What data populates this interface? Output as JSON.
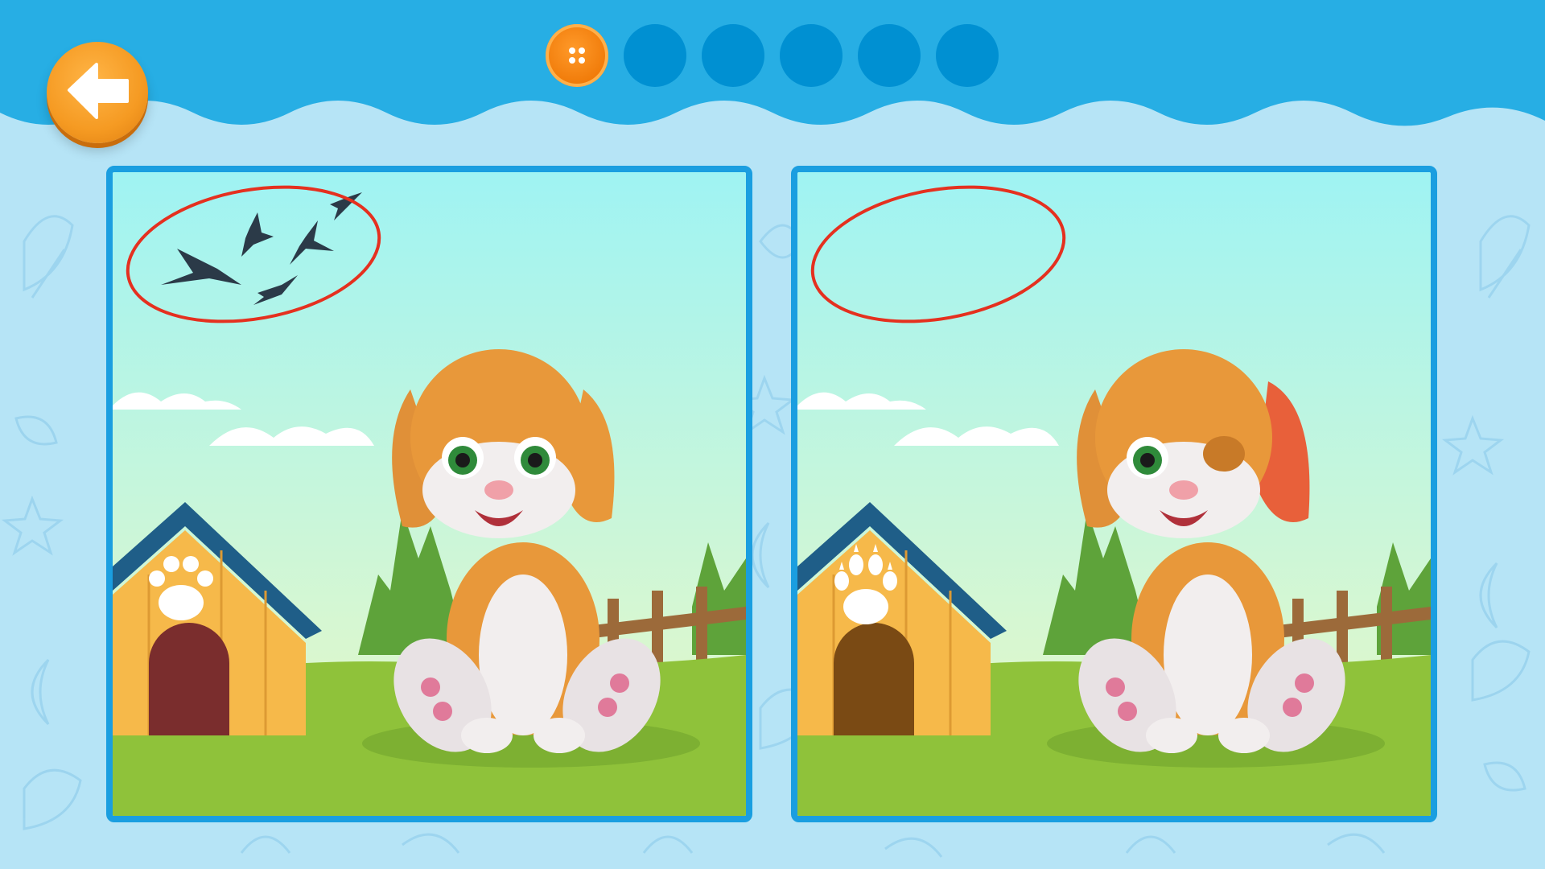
{
  "game": {
    "type": "spot-the-difference",
    "progress": {
      "total_rounds": 6,
      "current_round": 1
    }
  },
  "header": {
    "back_button_icon": "arrow-left-icon",
    "current_round_icon": "button-icon"
  },
  "scene": {
    "left_panel": {
      "found_difference": "birds-flock",
      "birds_visible": true,
      "door_color": "#7a2d2d",
      "paw_style": "round-pads",
      "dog_right_eye": "open",
      "dog_right_ear_color": "#e8983a"
    },
    "right_panel": {
      "found_difference": "birds-flock",
      "birds_visible": false,
      "door_color": "#7a4a14",
      "paw_style": "clawed",
      "dog_right_eye": "closed",
      "dog_right_ear_color": "#e8603a"
    }
  },
  "colors": {
    "header_blue": "#27aee4",
    "panel_border": "#1a9ee0",
    "progress_dot": "#0090d2",
    "back_button_orange": "#f59a22",
    "circle_mark": "#e5301f",
    "background": "#b6e4f6"
  }
}
